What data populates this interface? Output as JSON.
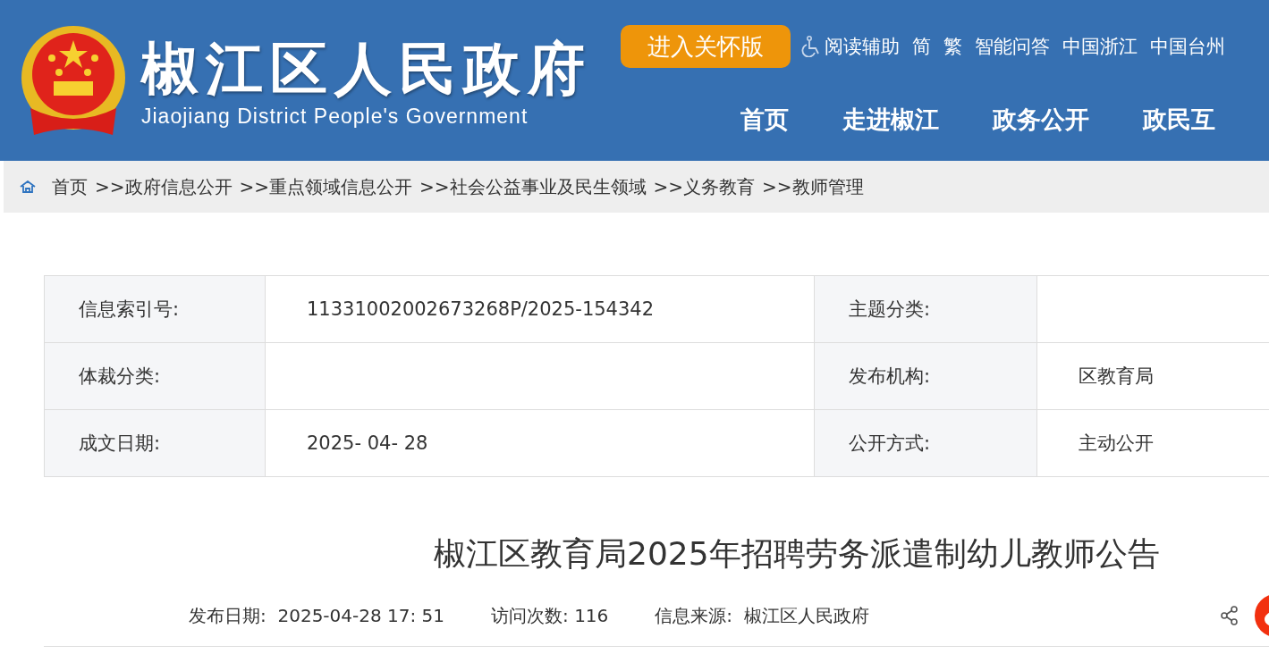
{
  "header": {
    "site_title": "椒江区人民政府",
    "site_subtitle": "Jiaojiang District People's Government",
    "care_button": "进入关怀版",
    "top_links": [
      {
        "label": "阅读辅助",
        "kind": "accessibility"
      },
      {
        "label": "简",
        "kind": "plain"
      },
      {
        "label": "繁",
        "kind": "plain"
      },
      {
        "label": "智能问答",
        "kind": "plain"
      },
      {
        "label": "中国浙江",
        "kind": "plain"
      },
      {
        "label": "中国台州",
        "kind": "plain"
      }
    ],
    "nav": [
      "首页",
      "走进椒江",
      "政务公开",
      "政民互"
    ]
  },
  "breadcrumb": [
    "首页",
    ">>政府信息公开",
    ">>重点领域信息公开",
    ">>社会公益事业及民生领域",
    ">>义务教育",
    ">>教师管理"
  ],
  "info_table": {
    "rows": [
      [
        {
          "label": "信息索引号:",
          "value": "11331002002673268P/2025-154342"
        },
        {
          "label": "主题分类:"
        }
      ],
      [
        {
          "label": "体裁分类:"
        },
        {
          "label": "发布机构:",
          "value": "区教育局"
        }
      ],
      [
        {
          "label": "成文日期:",
          "value": "2025- 04- 28"
        },
        {
          "label": "公开方式:",
          "value": "主动公开"
        }
      ]
    ]
  },
  "article": {
    "title": "椒江区教育局2025年招聘劳务派遣制幼儿教师公告",
    "meta": [
      "发布日期:  2025-04-28 17: 51",
      "访问次数: 116",
      "信息来源:  椒江区人民政府"
    ]
  }
}
